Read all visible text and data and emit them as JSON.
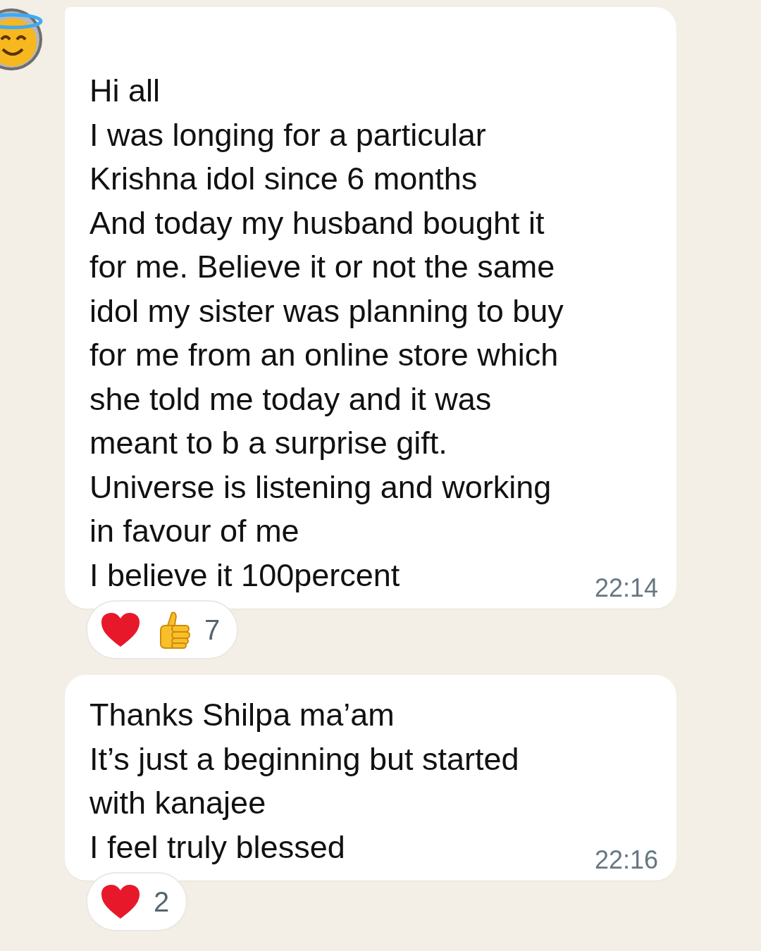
{
  "messages": [
    {
      "text": "Hi all\nI was longing for a particular\nKrishna idol since 6 months\nAnd today my husband bought it\nfor me. Believe it or not the same\nidol my sister was planning to buy\nfor me from an online store which\nshe told me today and it was\nmeant to b a surprise gift.\nUniverse is listening and working\nin favour of me\nI believe it 100percent",
      "time": "22:14",
      "first_in_group": true,
      "reactions": {
        "emojis": [
          {
            "kind": "heart"
          },
          {
            "kind": "thumbs-up"
          }
        ],
        "count": "7"
      }
    },
    {
      "text": "Thanks Shilpa ma’am\nIt’s just a beginning but started\nwith kanajee\nI feel truly blessed",
      "time": "22:16",
      "first_in_group": false,
      "reactions": {
        "emojis": [
          {
            "kind": "heart"
          }
        ],
        "count": "2"
      }
    }
  ]
}
